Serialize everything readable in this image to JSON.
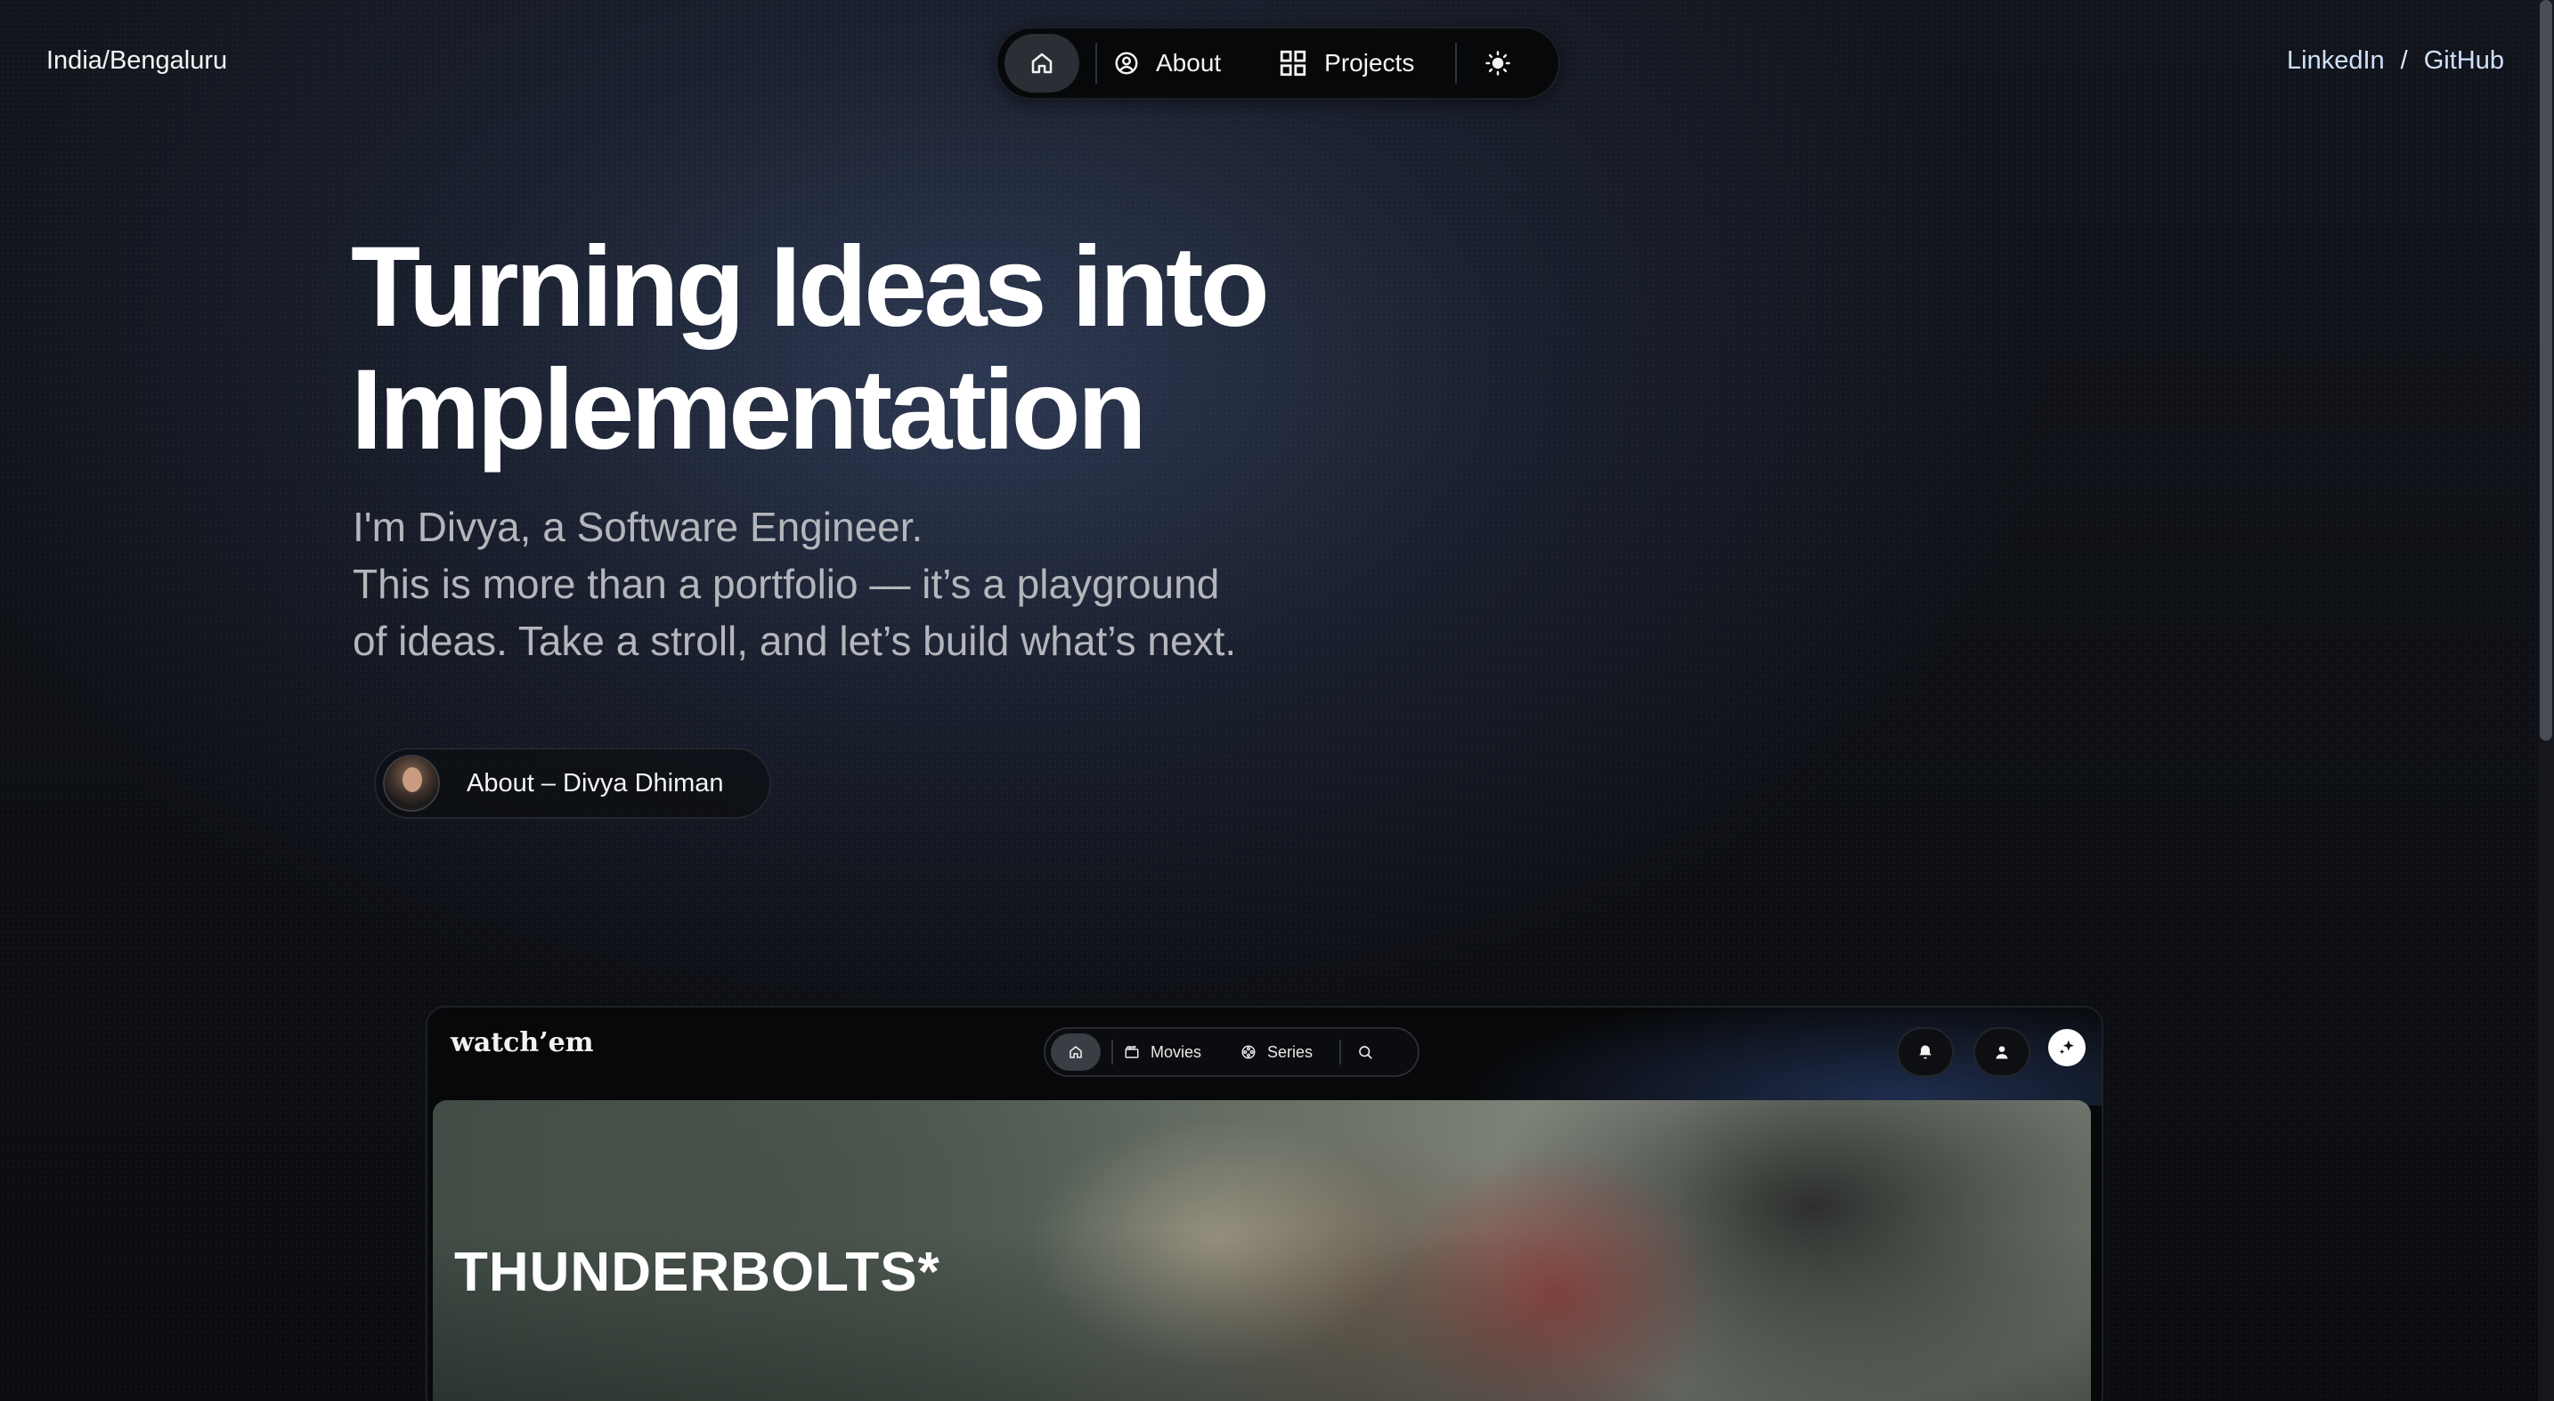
{
  "header": {
    "location": "India/Bengaluru",
    "nav": {
      "home_icon": "home-icon",
      "about_label": "About",
      "about_icon": "user-circle-icon",
      "projects_label": "Projects",
      "projects_icon": "grid-icon",
      "theme_icon": "sun-icon"
    },
    "links": {
      "linkedin": "LinkedIn",
      "separator": "/",
      "github": "GitHub"
    }
  },
  "hero": {
    "title_line1": "Turning Ideas into",
    "title_line2": "Implementation",
    "subtitle_line1": "I'm Divya, a Software Engineer.",
    "subtitle_line2": "This is more than a portfolio — it’s a playground",
    "subtitle_line3": "of ideas. Take a stroll, and let’s build what’s next.",
    "about_button_label": "About – Divya Dhiman"
  },
  "project_preview": {
    "logo": "watch’em",
    "nav": {
      "movies_label": "Movies",
      "series_label": "Series"
    },
    "featured_title": "THUNDERBOLTS*"
  },
  "colors": {
    "background": "#0b0c10",
    "link": "#cfe1ff",
    "subtitle": "#b4b6bb"
  }
}
